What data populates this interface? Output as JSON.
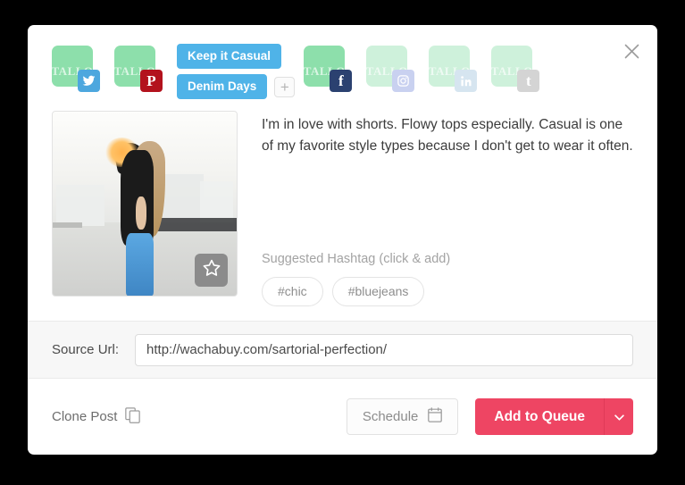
{
  "modal": {
    "close_label": "close-icon"
  },
  "accounts": [
    {
      "avatar_text": "TALLO",
      "network": "twitter",
      "active": true
    },
    {
      "avatar_text": "TALLO",
      "network": "pinterest",
      "active": true
    },
    {
      "avatar_text": "TALLO",
      "network": "facebook",
      "active": true
    },
    {
      "avatar_text": "TALLO",
      "network": "instagram",
      "active": false
    },
    {
      "avatar_text": "TALLO",
      "network": "linkedin",
      "active": false
    },
    {
      "avatar_text": "TALLO",
      "network": "tumblr",
      "active": false
    }
  ],
  "tags": {
    "items": [
      "Keep it Casual",
      "Denim Days"
    ],
    "add_label": "+"
  },
  "post": {
    "text": "I'm in love with shorts. Flowy tops especially. Casual is one of my favorite style types because I don't get to wear it often.",
    "image_alt": "woman-in-black-top-and-blue-jeans-outdoors",
    "favorite_icon": "star-icon"
  },
  "hashtags": {
    "label": "Suggested Hashtag (click & add)",
    "items": [
      "#chic",
      "#bluejeans"
    ]
  },
  "source": {
    "label": "Source Url:",
    "value": "http://wachabuy.com/sartorial-perfection/",
    "placeholder": "http://"
  },
  "footer": {
    "clone_label": "Clone Post",
    "clone_icon": "copy-icon",
    "schedule_label": "Schedule",
    "schedule_icon": "calendar-icon",
    "queue_label": "Add to Queue",
    "queue_caret_icon": "chevron-down-icon"
  },
  "colors": {
    "accent_red": "#ee4563",
    "tag_blue": "#4fb3e8",
    "avatar_green": "#8ddfab"
  }
}
